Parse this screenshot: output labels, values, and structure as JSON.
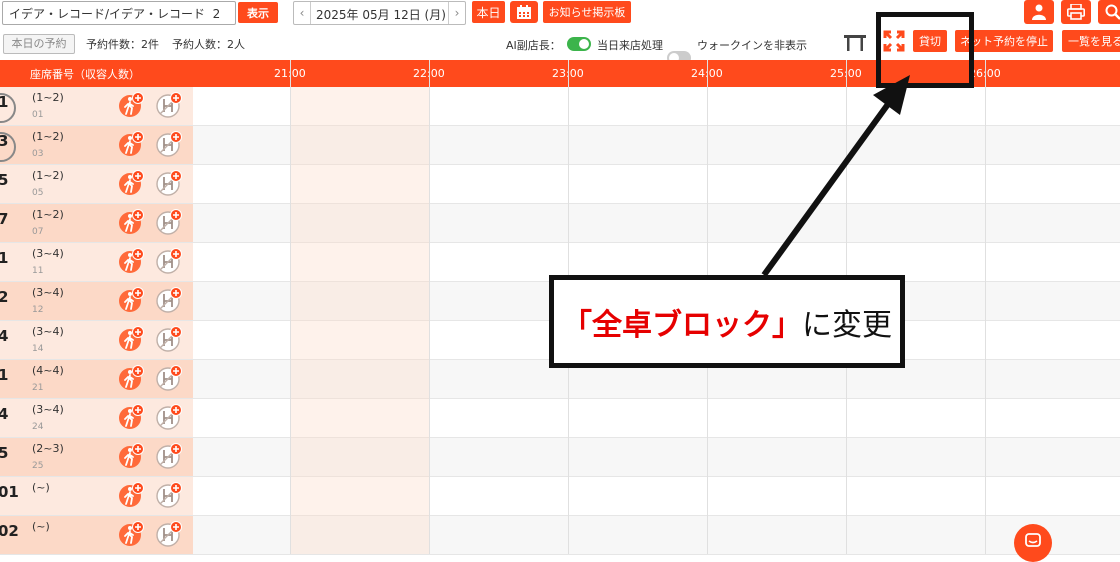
{
  "search": {
    "value": "イデア・レコード/イデア・レコード  2"
  },
  "toolbar": {
    "show_label": "表示",
    "date_label": "2025年 05月 12日 (月)",
    "today_label": "本日",
    "notice_label": "お知らせ掲示板",
    "today_reservations_label": "本日の予約",
    "reservation_count": "予約件数：2件",
    "guest_count": "予約人数：2人",
    "ai_manager_label": "AI副店長：",
    "same_day_label": "当日来店処理",
    "walkin_label": "ウォークインを非表示",
    "rental_label": "貸切",
    "stop_net_label": "ネット予約を停止",
    "list_label": "一覧を見る"
  },
  "timeline": {
    "header_label": "座席番号（収容人数）",
    "times": [
      "21:00",
      "22:00",
      "23:00",
      "24:00",
      "25:00",
      "26:00"
    ]
  },
  "seats": [
    {
      "num": "1",
      "cap": "(1~2)",
      "code": "01"
    },
    {
      "num": "3",
      "cap": "(1~2)",
      "code": "03"
    },
    {
      "num": "5",
      "cap": "(1~2)",
      "code": "05"
    },
    {
      "num": "7",
      "cap": "(1~2)",
      "code": "07"
    },
    {
      "num": "1",
      "cap": "(3~4)",
      "code": "11"
    },
    {
      "num": "2",
      "cap": "(3~4)",
      "code": "12"
    },
    {
      "num": "4",
      "cap": "(3~4)",
      "code": "14"
    },
    {
      "num": "1",
      "cap": "(4~4)",
      "code": "21"
    },
    {
      "num": "4",
      "cap": "(3~4)",
      "code": "24"
    },
    {
      "num": "5",
      "cap": "(2~3)",
      "code": "25"
    },
    {
      "num": "01",
      "cap": "(~)",
      "code": ""
    },
    {
      "num": "02",
      "cap": "(~)",
      "code": ""
    }
  ],
  "annotation": {
    "quote_open": "「",
    "highlight": "全卓ブロック",
    "quote_close": "」",
    "suffix": "に変更"
  },
  "colors": {
    "accent": "#ff4a1c",
    "highlight_text": "#e60000",
    "toggle_on": "#3cb44b"
  }
}
